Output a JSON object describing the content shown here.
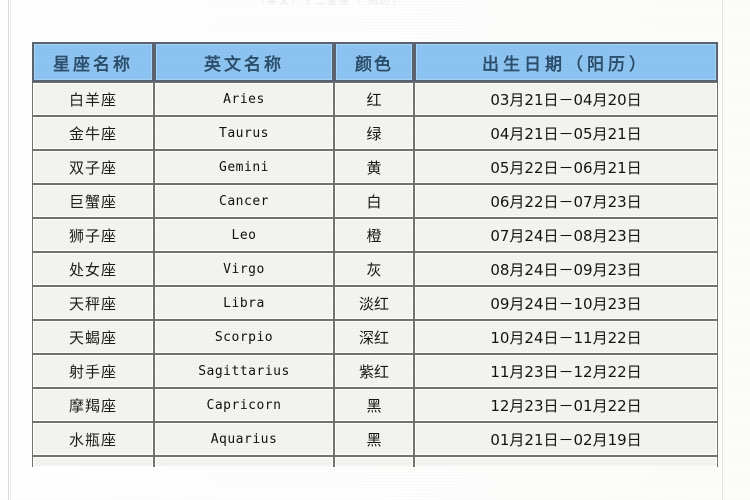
{
  "page": {
    "top_text_remnant": "（本文）十二星座（ 阳历）",
    "background_color": "#fdfdfc"
  },
  "table": {
    "name": "zodiac-signs-table",
    "header_background": "#8cc3f0",
    "header_text_color": "#2a4f6e",
    "cell_background": "#f3f3ef",
    "border_color": "#6f726d",
    "columns": [
      "星座名称",
      "英文名称",
      "颜色",
      "出生日期（阳历）"
    ],
    "rows": [
      {
        "name_cn": "白羊座",
        "name_en": "Aries",
        "color": "红",
        "date": "03月21日－04月20日"
      },
      {
        "name_cn": "金牛座",
        "name_en": "Taurus",
        "color": "绿",
        "date": "04月21日－05月21日"
      },
      {
        "name_cn": "双子座",
        "name_en": "Gemini",
        "color": "黄",
        "date": "05月22日－06月21日"
      },
      {
        "name_cn": "巨蟹座",
        "name_en": "Cancer",
        "color": "白",
        "date": "06月22日－07月23日"
      },
      {
        "name_cn": "狮子座",
        "name_en": "Leo",
        "color": "橙",
        "date": "07月24日－08月23日"
      },
      {
        "name_cn": "处女座",
        "name_en": "Virgo",
        "color": "灰",
        "date": "08月24日－09月23日"
      },
      {
        "name_cn": "天秤座",
        "name_en": "Libra",
        "color": "淡红",
        "date": "09月24日－10月23日"
      },
      {
        "name_cn": "天蝎座",
        "name_en": "Scorpio",
        "color": "深红",
        "date": "10月24日－11月22日"
      },
      {
        "name_cn": "射手座",
        "name_en": "Sagittarius",
        "color": "紫红",
        "date": "11月23日－12月22日"
      },
      {
        "name_cn": "摩羯座",
        "name_en": "Capricorn",
        "color": "黑",
        "date": "12月23日－01月22日"
      },
      {
        "name_cn": "水瓶座",
        "name_en": "Aquarius",
        "color": "黑",
        "date": "01月21日－02月19日"
      }
    ]
  }
}
